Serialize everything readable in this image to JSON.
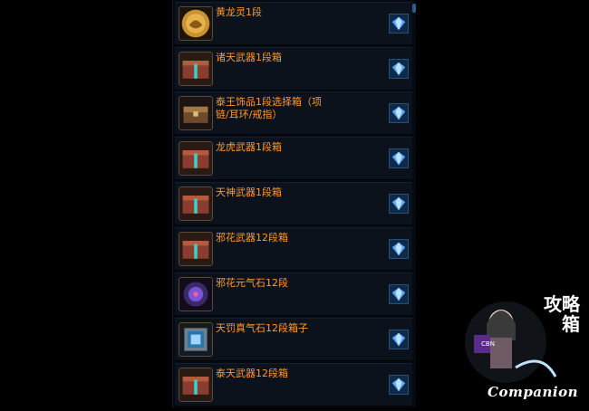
{
  "items": [
    {
      "label": "黄龙灵1段",
      "icon": "golden-medallion-icon"
    },
    {
      "label": "诸天武器1段箱",
      "icon": "weapon-chest-icon"
    },
    {
      "label": "泰王饰品1段选择箱（项链/耳环/戒指）",
      "icon": "ornament-chest-icon"
    },
    {
      "label": "龙虎武器1段箱",
      "icon": "weapon-chest-icon"
    },
    {
      "label": "天神武器1段箱",
      "icon": "weapon-chest-icon"
    },
    {
      "label": "邪花武器12段箱",
      "icon": "weapon-chest-icon"
    },
    {
      "label": "邪花元气石12段",
      "icon": "purple-orb-icon"
    },
    {
      "label": "天罚真气石12段箱子",
      "icon": "silver-box-icon"
    },
    {
      "label": "泰天武器12段箱",
      "icon": "weapon-chest-icon"
    }
  ],
  "watermark": {
    "text": "Companion",
    "glyphs": "攻略箱"
  },
  "colors": {
    "label": "#ff9a2f",
    "row_bg": "#0b121c",
    "gem": "#6fb6ff"
  }
}
